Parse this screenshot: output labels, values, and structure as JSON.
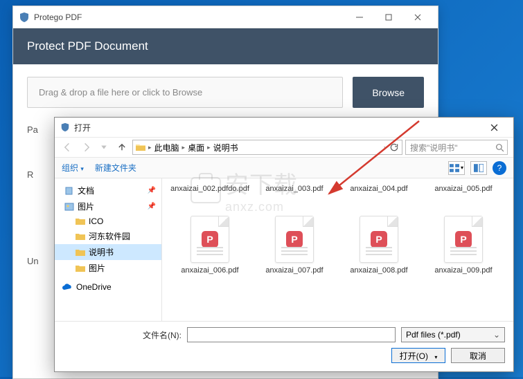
{
  "mainWindow": {
    "title": "Protego PDF",
    "heading": "Protect PDF Document",
    "dropZoneText": "Drag & drop a file here or click to Browse",
    "browseLabel": "Browse",
    "passwordRowLabel": "Pa",
    "readonlyRowLabel": "R",
    "unlockRowLabel": "Un"
  },
  "fileDialog": {
    "title": "打开",
    "breadcrumb": {
      "thisPC": "此电脑",
      "desktop": "桌面",
      "folder": "说明书"
    },
    "searchPlaceholder": "搜索\"说明书\"",
    "toolbar": {
      "organize": "组织",
      "newFolder": "新建文件夹"
    },
    "tree": {
      "documents": "文档",
      "pictures": "图片",
      "ico": "ICO",
      "hedong": "河东软件园",
      "manual": "说明书",
      "pictures2": "图片",
      "onedrive": "OneDrive"
    },
    "files": {
      "f1": "anxaizai_002.pdfdo.pdf",
      "f2": "anxaizai_003.pdf",
      "f3": "anxaizai_004.pdf",
      "f4": "anxaizai_005.pdf",
      "f5": "anxaizai_006.pdf",
      "f6": "anxaizai_007.pdf",
      "f7": "anxaizai_008.pdf",
      "f8": "anxaizai_009.pdf"
    },
    "filenameLabel": "文件名(N):",
    "fileTypeLabel": "Pdf files (*.pdf)",
    "openBtn": "打开(O)",
    "cancelBtn": "取消"
  },
  "watermark": {
    "text1": "安下载",
    "text2": "anxz.com"
  }
}
